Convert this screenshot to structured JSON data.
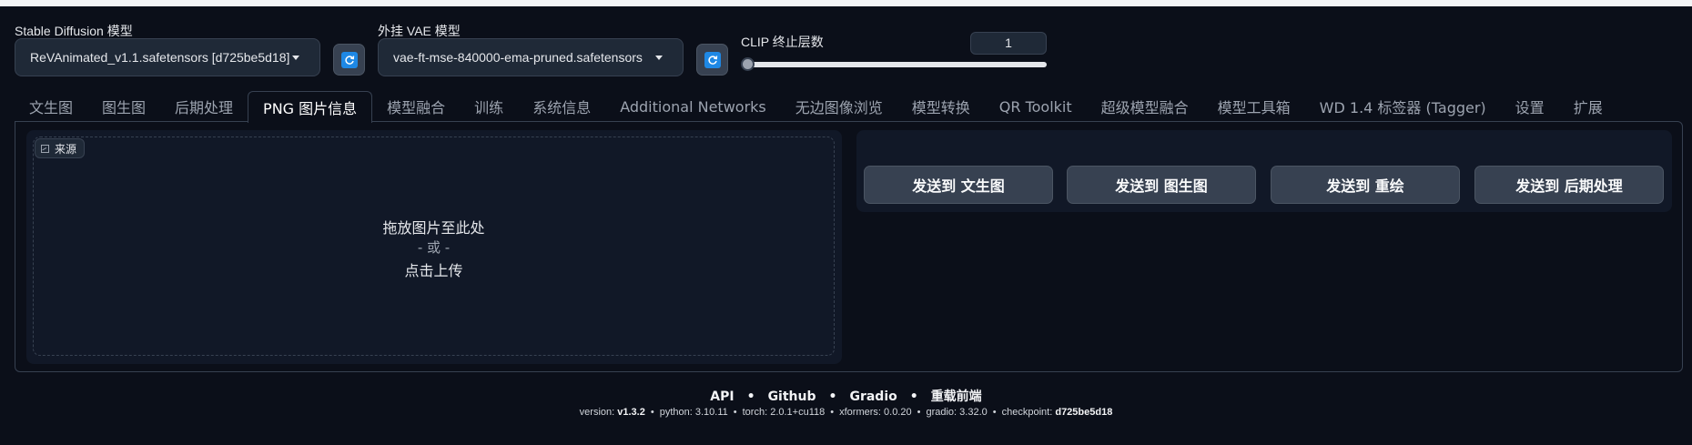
{
  "header": {
    "sd_model": {
      "label": "Stable Diffusion 模型",
      "value": "ReVAnimated_v1.1.safetensors [d725be5d18]"
    },
    "vae_model": {
      "label": "外挂 VAE 模型",
      "value": "vae-ft-mse-840000-ema-pruned.safetensors"
    },
    "clip": {
      "label": "CLIP 终止层数",
      "value": "1",
      "fraction": 0
    }
  },
  "tabs": [
    {
      "label": "文生图"
    },
    {
      "label": "图生图"
    },
    {
      "label": "后期处理"
    },
    {
      "label": "PNG 图片信息"
    },
    {
      "label": "模型融合"
    },
    {
      "label": "训练"
    },
    {
      "label": "系统信息"
    },
    {
      "label": "Additional Networks"
    },
    {
      "label": "无边图像浏览"
    },
    {
      "label": "模型转换"
    },
    {
      "label": "QR Toolkit"
    },
    {
      "label": "超级模型融合"
    },
    {
      "label": "模型工具箱"
    },
    {
      "label": "WD 1.4 标签器 (Tagger)"
    },
    {
      "label": "设置"
    },
    {
      "label": "扩展"
    }
  ],
  "active_tab": "PNG 图片信息",
  "upload": {
    "source_label": "来源",
    "drop_text": "拖放图片至此处",
    "or_text": "- 或 -",
    "click_text": "点击上传"
  },
  "send_buttons": [
    {
      "label": "发送到 文生图"
    },
    {
      "label": "发送到 图生图"
    },
    {
      "label": "发送到 重绘"
    },
    {
      "label": "发送到 后期处理"
    }
  ],
  "footer": {
    "links": [
      "API",
      "Github",
      "Gradio",
      "重载前端"
    ],
    "version": [
      {
        "key": "version:",
        "value": "v1.3.2"
      },
      {
        "key": "python:",
        "value": "3.10.11"
      },
      {
        "key": "torch:",
        "value": "2.0.1+cu118"
      },
      {
        "key": "xformers:",
        "value": "0.0.20"
      },
      {
        "key": "gradio:",
        "value": "3.32.0"
      },
      {
        "key": "checkpoint:",
        "value": "d725be5d18"
      }
    ]
  },
  "colors": {
    "background": "#0b0f19",
    "panel": "#111827",
    "button": "#374151",
    "refresh_accent": "#1e88e5"
  }
}
